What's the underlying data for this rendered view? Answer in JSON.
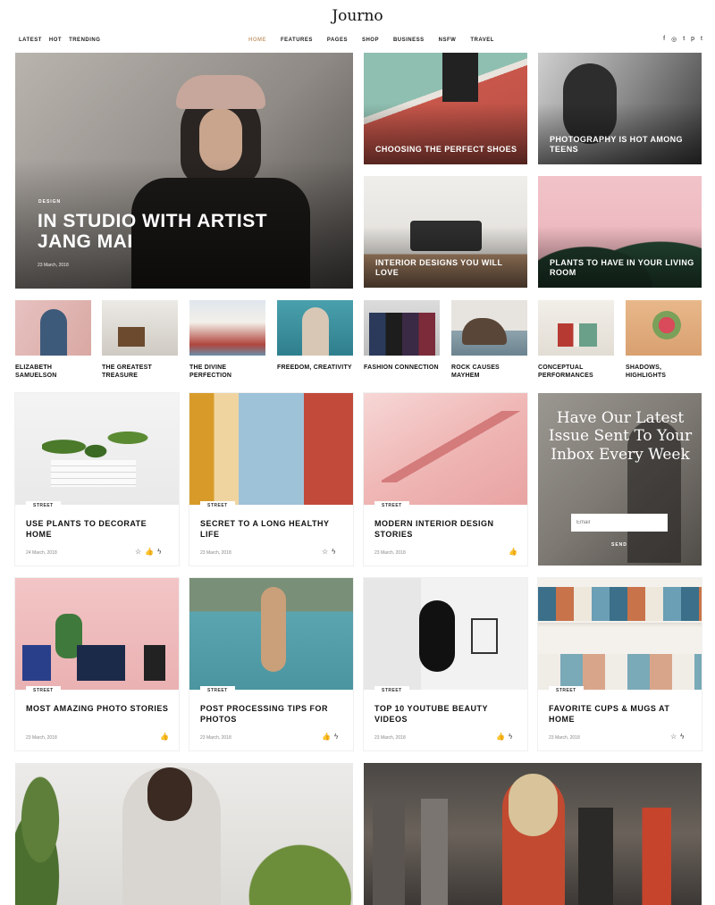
{
  "header": {
    "logo": "Journo",
    "left_links": [
      "LATEST",
      "HOT",
      "TRENDING"
    ],
    "menu": [
      "HOME",
      "FEATURES",
      "PAGES",
      "SHOP",
      "BUSINESS",
      "NSFW",
      "TRAVEL"
    ],
    "social": [
      "f",
      "◎",
      "t",
      "p",
      "t"
    ]
  },
  "hero": {
    "tag": "DESIGN",
    "title": "IN STUDIO WITH ARTIST JANG MAI",
    "date": "23 March, 2018"
  },
  "tiles": [
    {
      "title": "CHOOSING THE PERFECT SHOES"
    },
    {
      "title": "PHOTOGRAPHY IS HOT AMONG TEENS"
    },
    {
      "title": "INTERIOR DESIGNS YOU WILL LOVE"
    },
    {
      "title": "PLANTS TO HAVE IN YOUR LIVING ROOM"
    }
  ],
  "strip": [
    {
      "label": "ELIZABETH SAMUELSON"
    },
    {
      "label": "THE GREATEST TREASURE"
    },
    {
      "label": "THE DIVINE PERFECTION"
    },
    {
      "label": "FREEDOM, CREATIVITY"
    },
    {
      "label": "FASHION CONNECTION"
    },
    {
      "label": "ROCK CAUSES MAYHEM"
    },
    {
      "label": "CONCEPTUAL PERFORMANCES"
    },
    {
      "label": "SHADOWS, HIGHLIGHTS"
    }
  ],
  "cards": [
    {
      "tag": "STREET",
      "title": "USE PLANTS TO DECORATE HOME",
      "date": "24 March, 2018"
    },
    {
      "tag": "STREET",
      "title": "SECRET TO A LONG HEALTHY LIFE",
      "date": "23 March, 2018"
    },
    {
      "tag": "STREET",
      "title": "MODERN INTERIOR DESIGN STORIES",
      "date": "23 March, 2018"
    },
    {
      "tag": "STREET",
      "title": "MOST AMAZING PHOTO STORIES",
      "date": "23 March, 2018"
    },
    {
      "tag": "STREET",
      "title": "POST PROCESSING TIPS FOR PHOTOS",
      "date": "23 March, 2018"
    },
    {
      "tag": "STREET",
      "title": "TOP 10 YOUTUBE BEAUTY VIDEOS",
      "date": "23 March, 2018"
    },
    {
      "tag": "STREET",
      "title": "FAVORITE CUPS & MUGS AT HOME",
      "date": "23 March, 2018"
    }
  ],
  "newsletter": {
    "title": "Have Our Latest Issue Sent To Your Inbox Every Week",
    "placeholder": "Email",
    "send": "SEND"
  }
}
